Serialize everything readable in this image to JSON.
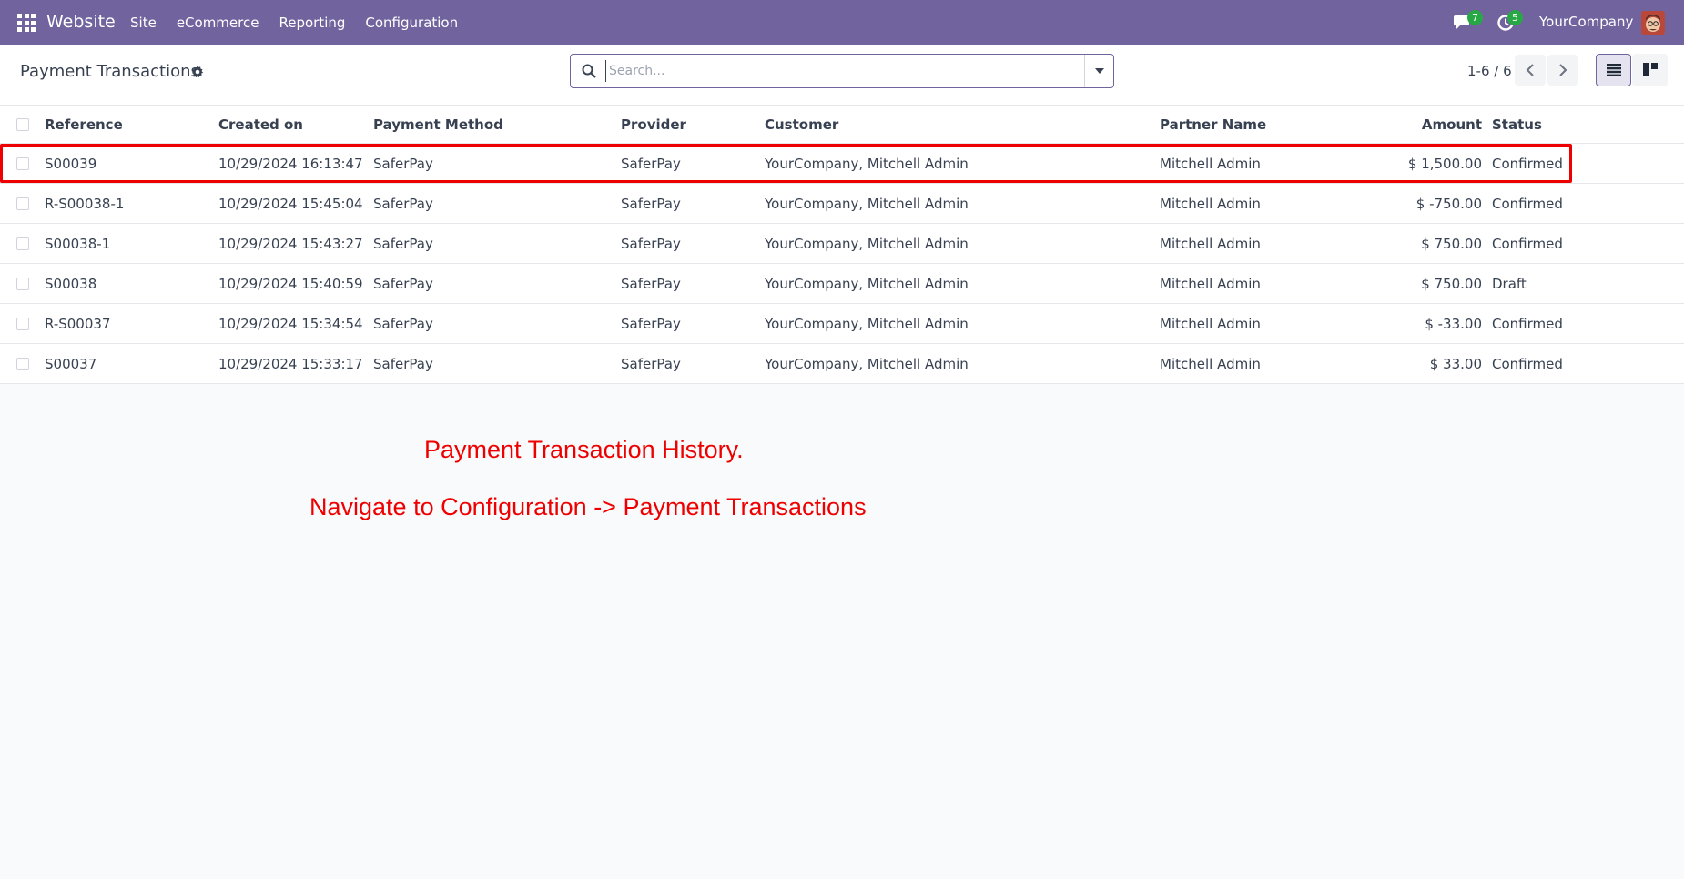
{
  "navbar": {
    "brand": "Website",
    "menu": [
      "Site",
      "eCommerce",
      "Reporting",
      "Configuration"
    ],
    "chat_count": "7",
    "activity_count": "5",
    "company": "YourCompany",
    "apps_icon": "grid-icon",
    "chat_icon": "chat-icon",
    "activity_icon": "clock-icon",
    "bar_color": "#71639e"
  },
  "control_panel": {
    "title": "Payment Transactions",
    "title_icon": "gear-icon",
    "search_placeholder": "Search...",
    "pager": "1-6 / 6",
    "views": [
      "list",
      "kanban"
    ],
    "active_view": "list"
  },
  "table": {
    "headers": {
      "reference": "Reference",
      "created_on": "Created on",
      "payment_method": "Payment Method",
      "provider": "Provider",
      "customer": "Customer",
      "partner_name": "Partner Name",
      "amount": "Amount",
      "status": "Status"
    },
    "rows": [
      {
        "reference": "S00039",
        "created_on": "10/29/2024 16:13:47",
        "payment_method": "SaferPay",
        "provider": "SaferPay",
        "customer": "YourCompany, Mitchell Admin",
        "partner_name": "Mitchell Admin",
        "amount": "$ 1,500.00",
        "status": "Confirmed"
      },
      {
        "reference": "R-S00038-1",
        "created_on": "10/29/2024 15:45:04",
        "payment_method": "SaferPay",
        "provider": "SaferPay",
        "customer": "YourCompany, Mitchell Admin",
        "partner_name": "Mitchell Admin",
        "amount": "$ -750.00",
        "status": "Confirmed"
      },
      {
        "reference": "S00038-1",
        "created_on": "10/29/2024 15:43:27",
        "payment_method": "SaferPay",
        "provider": "SaferPay",
        "customer": "YourCompany, Mitchell Admin",
        "partner_name": "Mitchell Admin",
        "amount": "$ 750.00",
        "status": "Confirmed"
      },
      {
        "reference": "S00038",
        "created_on": "10/29/2024 15:40:59",
        "payment_method": "SaferPay",
        "provider": "SaferPay",
        "customer": "YourCompany, Mitchell Admin",
        "partner_name": "Mitchell Admin",
        "amount": "$ 750.00",
        "status": "Draft"
      },
      {
        "reference": "R-S00037",
        "created_on": "10/29/2024 15:34:54",
        "payment_method": "SaferPay",
        "provider": "SaferPay",
        "customer": "YourCompany, Mitchell Admin",
        "partner_name": "Mitchell Admin",
        "amount": "$ -33.00",
        "status": "Confirmed"
      },
      {
        "reference": "S00037",
        "created_on": "10/29/2024 15:33:17",
        "payment_method": "SaferPay",
        "provider": "SaferPay",
        "customer": "YourCompany, Mitchell Admin",
        "partner_name": "Mitchell Admin",
        "amount": "$ 33.00",
        "status": "Confirmed"
      }
    ]
  },
  "annotations": {
    "line1": "Payment Transaction History.",
    "line2": "Navigate to Configuration -> Payment Transactions",
    "color": "#ee0000"
  }
}
